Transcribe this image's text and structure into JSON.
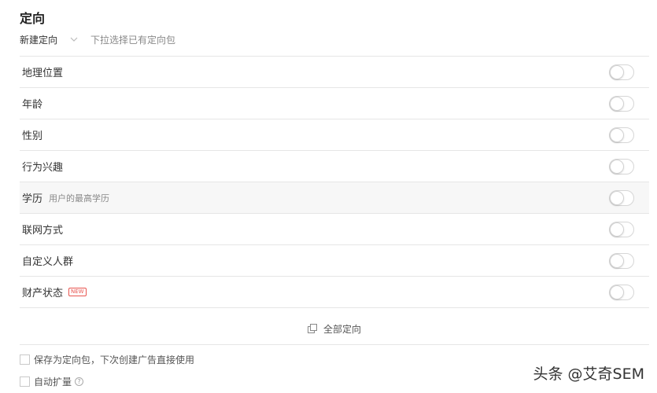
{
  "section_title": "定向",
  "package": {
    "selected": "新建定向",
    "placeholder": "下拉选择已有定向包"
  },
  "rows": [
    {
      "label": "地理位置",
      "desc": "",
      "badge": "",
      "enabled": false
    },
    {
      "label": "年龄",
      "desc": "",
      "badge": "",
      "enabled": false
    },
    {
      "label": "性别",
      "desc": "",
      "badge": "",
      "enabled": false
    },
    {
      "label": "行为兴趣",
      "desc": "",
      "badge": "",
      "enabled": false
    },
    {
      "label": "学历",
      "desc": "用户的最高学历",
      "badge": "",
      "enabled": false
    },
    {
      "label": "联网方式",
      "desc": "",
      "badge": "",
      "enabled": false
    },
    {
      "label": "自定义人群",
      "desc": "",
      "badge": "",
      "enabled": false
    },
    {
      "label": "财产状态",
      "desc": "",
      "badge": "NEW",
      "enabled": false
    }
  ],
  "all_targeting_label": "全部定向",
  "save_package_label": "保存为定向包，下次创建广告直接使用",
  "auto_expand_label": "自动扩量",
  "help_glyph": "?",
  "watermark": "头条 @艾奇SEM",
  "colors": {
    "badge": "#e8544f",
    "highlight_row": "#f7f7f7",
    "divider": "#e6e6e6"
  }
}
